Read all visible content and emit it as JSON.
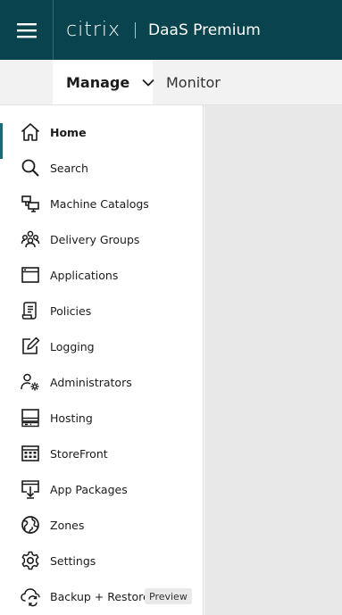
{
  "header": {
    "brand_logo": "citrix",
    "product_name": "DaaS Premium",
    "background_color": "#09434d",
    "menu_icon": "hamburger-menu-icon"
  },
  "subnav": {
    "tabs": [
      {
        "label": "Manage",
        "selected": true,
        "icon": "chevron-down-icon"
      },
      {
        "label": "Monitor",
        "selected": false
      }
    ]
  },
  "sidebar": {
    "accent_color": "#1c6b74",
    "items": [
      {
        "label": "Home",
        "icon": "home-icon",
        "active": true
      },
      {
        "label": "Search",
        "icon": "search-icon"
      },
      {
        "label": "Machine Catalogs",
        "icon": "machine-catalogs-icon"
      },
      {
        "label": "Delivery Groups",
        "icon": "delivery-groups-icon"
      },
      {
        "label": "Applications",
        "icon": "applications-icon"
      },
      {
        "label": "Policies",
        "icon": "policies-icon"
      },
      {
        "label": "Logging",
        "icon": "logging-icon"
      },
      {
        "label": "Administrators",
        "icon": "administrators-icon"
      },
      {
        "label": "Hosting",
        "icon": "hosting-icon"
      },
      {
        "label": "StoreFront",
        "icon": "storefront-icon"
      },
      {
        "label": "App Packages",
        "icon": "app-packages-icon"
      },
      {
        "label": "Zones",
        "icon": "zones-icon"
      },
      {
        "label": "Settings",
        "icon": "settings-icon"
      },
      {
        "label": "Backup + Restore",
        "icon": "backup-restore-icon",
        "badge": "Preview"
      }
    ]
  }
}
